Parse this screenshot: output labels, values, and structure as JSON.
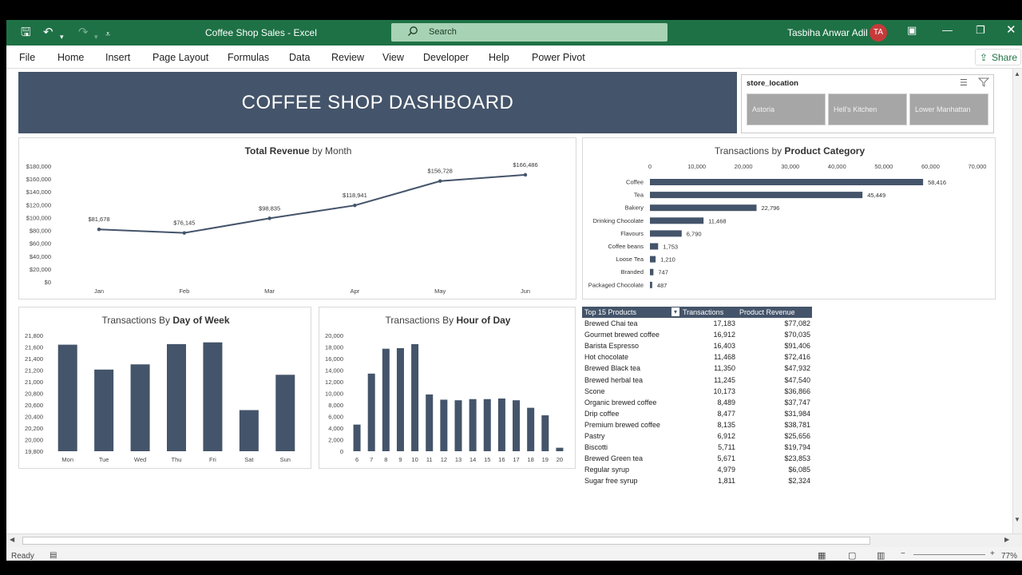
{
  "app": {
    "title": "Coffee Shop Sales  -  Excel",
    "search_placeholder": "Search",
    "user_name": "Tasbiha Anwar Adil",
    "user_initials": "TA"
  },
  "ribbon": {
    "tabs": [
      "File",
      "Home",
      "Insert",
      "Page Layout",
      "Formulas",
      "Data",
      "Review",
      "View",
      "Developer",
      "Help",
      "Power Pivot"
    ],
    "share_label": "Share"
  },
  "dashboard": {
    "title": "COFFEE SHOP DASHBOARD"
  },
  "slicer": {
    "header": "store_location",
    "items": [
      "Astoria",
      "Hell's Kitchen",
      "Lower Manhattan"
    ]
  },
  "revenue_chart": {
    "title_bold": "Total Revenue",
    "title_rest": " by Month"
  },
  "category_chart": {
    "title_rest": "Transactions by ",
    "title_bold": "Product Category"
  },
  "dow_chart": {
    "title_rest": "Transactions By ",
    "title_bold": "Day of  Week"
  },
  "hour_chart": {
    "title_rest": "Transactions By ",
    "title_bold": "Hour of Day"
  },
  "chart_data": [
    {
      "type": "line",
      "title": "Total Revenue by Month",
      "categories": [
        "Jan",
        "Feb",
        "Mar",
        "Apr",
        "May",
        "Jun"
      ],
      "values": [
        81678,
        76145,
        98835,
        118941,
        156728,
        166486
      ],
      "labels": [
        "$81,678",
        "$76,145",
        "$98,835",
        "$118,941",
        "$156,728",
        "$166,486"
      ],
      "y_ticks": [
        "$0",
        "$20,000",
        "$40,000",
        "$60,000",
        "$80,000",
        "$100,000",
        "$120,000",
        "$140,000",
        "$160,000",
        "$180,000"
      ],
      "ylim": [
        0,
        180000
      ],
      "color": "#44546a"
    },
    {
      "type": "bar",
      "orientation": "horizontal",
      "title": "Transactions by Product Category",
      "categories": [
        "Coffee",
        "Tea",
        "Bakery",
        "Drinking Chocolate",
        "Flavours",
        "Coffee beans",
        "Loose Tea",
        "Branded",
        "Packaged Chocolate"
      ],
      "values": [
        58416,
        45449,
        22796,
        11468,
        6790,
        1753,
        1210,
        747,
        487
      ],
      "labels": [
        "58,416",
        "45,449",
        "22,796",
        "11,468",
        "6,790",
        "1,753",
        "1,210",
        "747",
        "487"
      ],
      "x_ticks": [
        "0",
        "10,000",
        "20,000",
        "30,000",
        "40,000",
        "50,000",
        "60,000",
        "70,000"
      ],
      "xlim": [
        0,
        70000
      ],
      "color": "#44546a"
    },
    {
      "type": "bar",
      "title": "Transactions By Day of  Week",
      "categories": [
        "Mon",
        "Tue",
        "Wed",
        "Thu",
        "Fri",
        "Sat",
        "Sun"
      ],
      "values": [
        21640,
        21210,
        21300,
        21650,
        21680,
        20510,
        21120
      ],
      "y_ticks": [
        "19,800",
        "20,000",
        "20,200",
        "20,400",
        "20,600",
        "20,800",
        "21,000",
        "21,200",
        "21,400",
        "21,600",
        "21,800"
      ],
      "ylim": [
        19800,
        21800
      ],
      "color": "#44546a"
    },
    {
      "type": "bar",
      "title": "Transactions By Hour of Day",
      "categories": [
        "6",
        "7",
        "8",
        "9",
        "10",
        "11",
        "12",
        "13",
        "14",
        "15",
        "16",
        "17",
        "18",
        "19",
        "20"
      ],
      "values": [
        4600,
        13400,
        17700,
        17800,
        18500,
        9800,
        8900,
        8800,
        9000,
        9000,
        9100,
        8800,
        7500,
        6200,
        600
      ],
      "y_ticks": [
        "0",
        "2,000",
        "4,000",
        "6,000",
        "8,000",
        "10,000",
        "12,000",
        "14,000",
        "16,000",
        "18,000",
        "20,000"
      ],
      "ylim": [
        0,
        20000
      ],
      "color": "#44546a"
    }
  ],
  "top_products": {
    "headers": [
      "Top 15 Products",
      "Transactions",
      "Product Revenue"
    ],
    "rows": [
      [
        "Brewed Chai tea",
        "17,183",
        "$77,082"
      ],
      [
        "Gourmet brewed coffee",
        "16,912",
        "$70,035"
      ],
      [
        "Barista Espresso",
        "16,403",
        "$91,406"
      ],
      [
        "Hot chocolate",
        "11,468",
        "$72,416"
      ],
      [
        "Brewed Black tea",
        "11,350",
        "$47,932"
      ],
      [
        "Brewed herbal tea",
        "11,245",
        "$47,540"
      ],
      [
        "Scone",
        "10,173",
        "$36,866"
      ],
      [
        "Organic brewed coffee",
        "8,489",
        "$37,747"
      ],
      [
        "Drip coffee",
        "8,477",
        "$31,984"
      ],
      [
        "Premium brewed coffee",
        "8,135",
        "$38,781"
      ],
      [
        "Pastry",
        "6,912",
        "$25,656"
      ],
      [
        "Biscotti",
        "5,711",
        "$19,794"
      ],
      [
        "Brewed Green tea",
        "5,671",
        "$23,853"
      ],
      [
        "Regular syrup",
        "4,979",
        "$6,085"
      ],
      [
        "Sugar free syrup",
        "1,811",
        "$2,324"
      ]
    ]
  },
  "status": {
    "ready": "Ready",
    "zoom": "77%"
  },
  "colors": {
    "excel_green": "#1e7145",
    "chart_slate": "#44546a"
  }
}
